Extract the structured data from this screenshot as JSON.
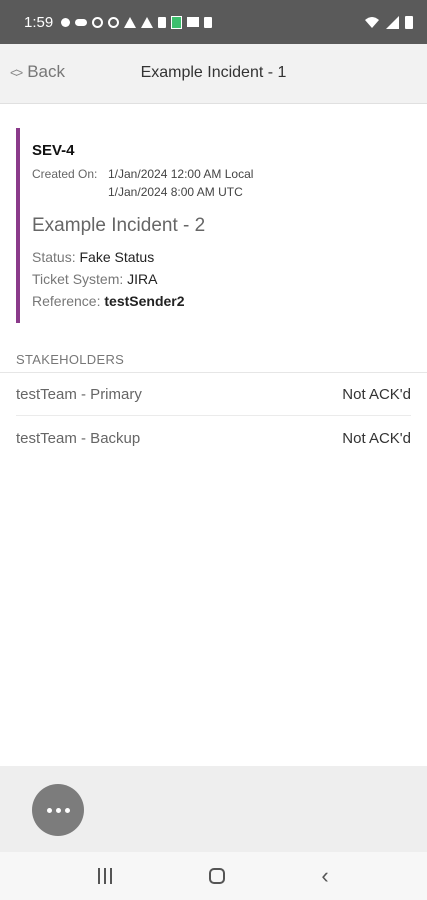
{
  "status_bar": {
    "time": "1:59"
  },
  "header": {
    "back_label": "Back",
    "title": "Example Incident - 1"
  },
  "incident": {
    "severity": "SEV-4",
    "created_label": "Created On:",
    "created_local": "1/Jan/2024 12:00 AM Local",
    "created_utc": "1/Jan/2024 8:00 AM UTC",
    "title": "Example Incident - 2",
    "status_label": "Status:",
    "status_value": "Fake Status",
    "ticket_label": "Ticket System:",
    "ticket_value": "JIRA",
    "reference_label": "Reference:",
    "reference_value": "testSender2",
    "accent_color": "#8a3a8a"
  },
  "stakeholders": {
    "header": "STAKEHOLDERS",
    "rows": [
      {
        "name": "testTeam - Primary",
        "status": "Not ACK'd"
      },
      {
        "name": "testTeam - Backup",
        "status": "Not ACK'd"
      }
    ]
  },
  "fab": {
    "icon": "more-horizontal-icon"
  },
  "system_nav": {
    "icons": [
      "recent-apps-icon",
      "home-icon",
      "back-icon"
    ]
  }
}
